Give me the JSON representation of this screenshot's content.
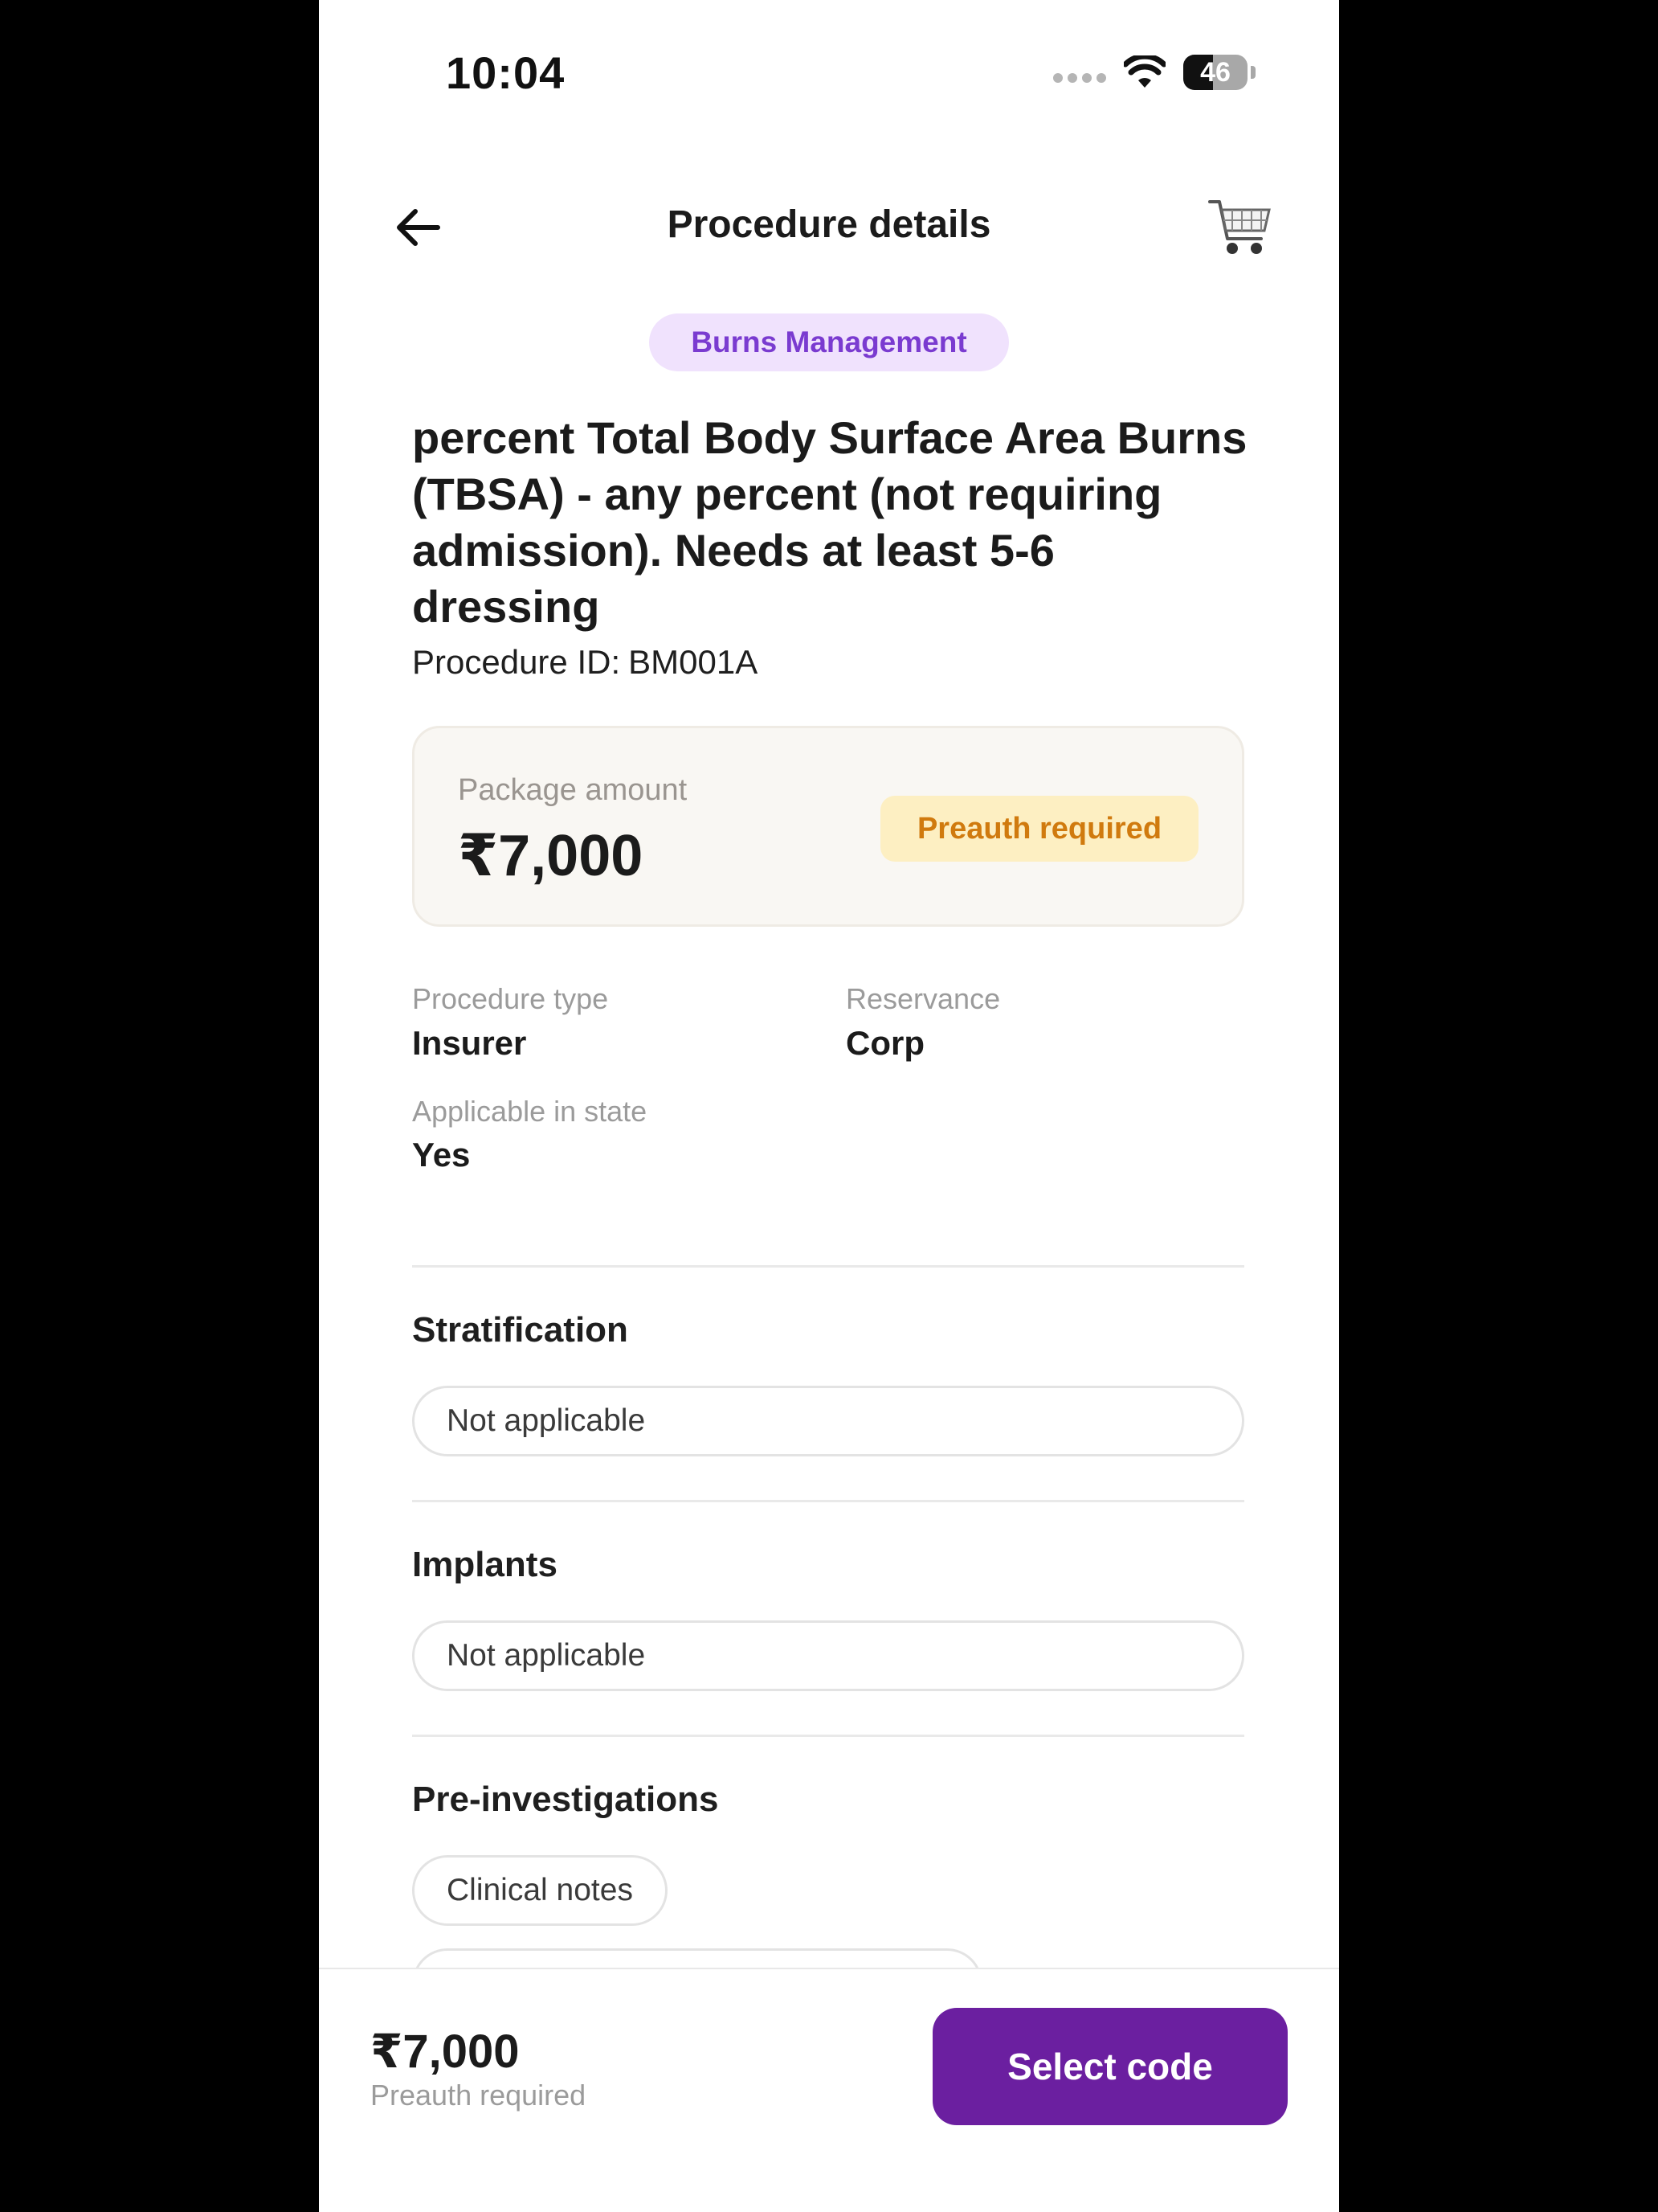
{
  "status_bar": {
    "time": "10:04",
    "battery_level": "46",
    "battery_fraction": 0.46
  },
  "header": {
    "title": "Procedure details",
    "back_icon": "arrow-left-icon",
    "cart_icon": "shopping-cart-icon"
  },
  "procedure": {
    "category": "Burns Management",
    "title": "percent Total Body Surface Area Burns (TBSA) - any  percent (not requiring admission). Needs at least 5-6 dressing",
    "id_label": "Procedure ID:",
    "id_value": "BM001A"
  },
  "package": {
    "label": "Package amount",
    "amount": "₹7,000",
    "badge": "Preauth required"
  },
  "info": {
    "procedure_type_label": "Procedure type",
    "procedure_type_value": "Insurer",
    "reservance_label": "Reservance",
    "reservance_value": "Corp",
    "applicable_label": "Applicable in state",
    "applicable_value": "Yes"
  },
  "sections": {
    "stratification": {
      "title": "Stratification",
      "value": "Not applicable"
    },
    "implants": {
      "title": "Implants",
      "value": "Not applicable"
    },
    "pre_investigations": {
      "title": "Pre-investigations",
      "items": [
        "Clinical notes"
      ]
    }
  },
  "footer": {
    "amount": "₹7,000",
    "subtitle": "Preauth required",
    "button_label": "Select code"
  },
  "colors": {
    "accent": "#6b1fa0",
    "chip_bg": "#f0e2fd",
    "chip_text": "#7a3bd0",
    "badge_bg": "#fdefc2",
    "badge_text": "#d07a0e"
  }
}
